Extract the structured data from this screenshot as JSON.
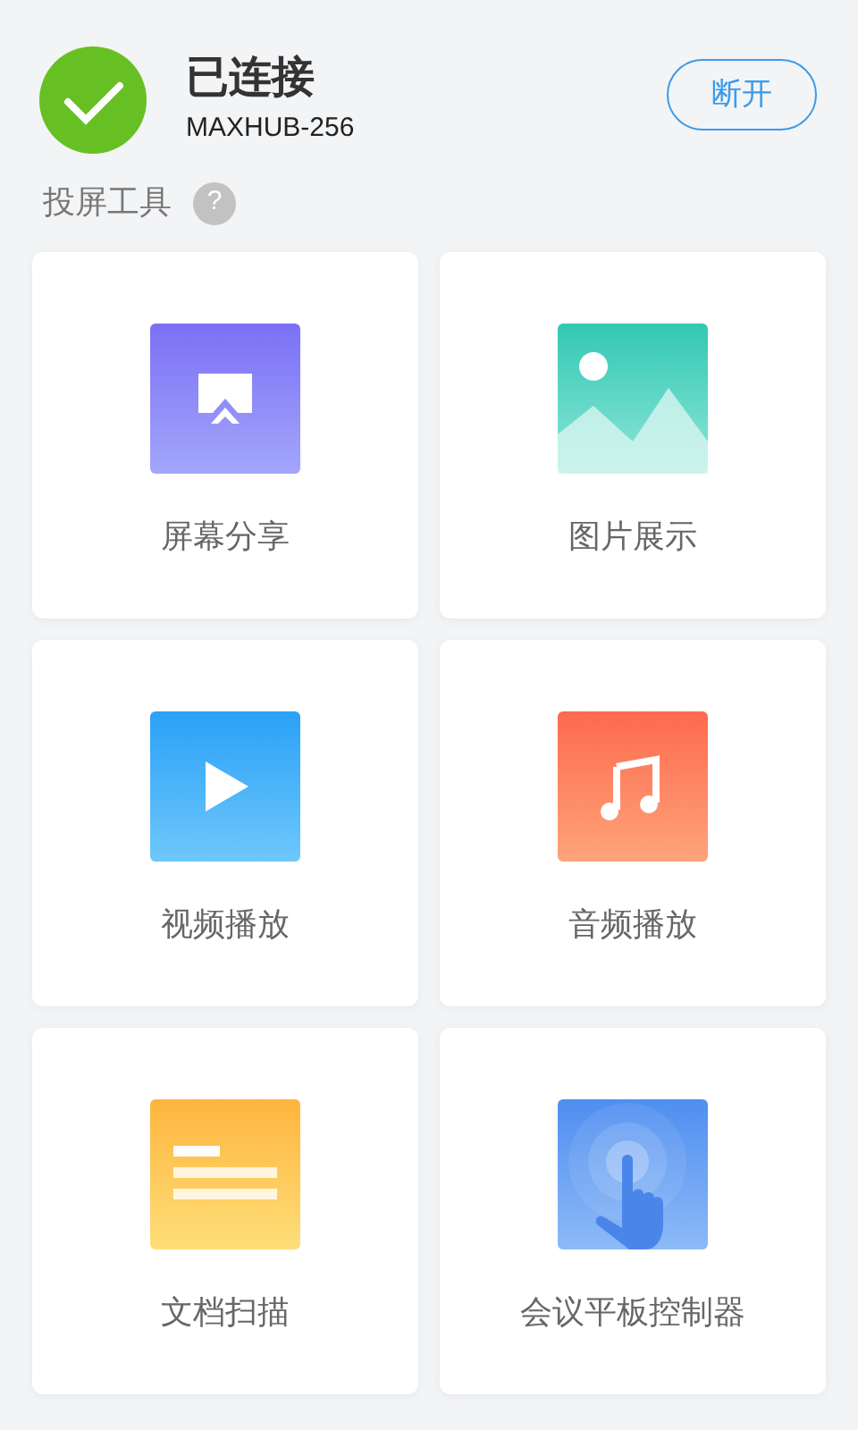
{
  "status": {
    "connected": true,
    "title": "已连接",
    "device": "MAXHUB-256"
  },
  "disconnect_button": "断开",
  "section": {
    "title": "投屏工具",
    "help": "?"
  },
  "tools": [
    {
      "kind": "screen-share",
      "label": "屏幕分享"
    },
    {
      "kind": "image",
      "label": "图片展示"
    },
    {
      "kind": "video",
      "label": "视频播放"
    },
    {
      "kind": "audio",
      "label": "音频播放"
    },
    {
      "kind": "document",
      "label": "文档扫描"
    },
    {
      "kind": "touch",
      "label": "会议平板控制器"
    }
  ]
}
